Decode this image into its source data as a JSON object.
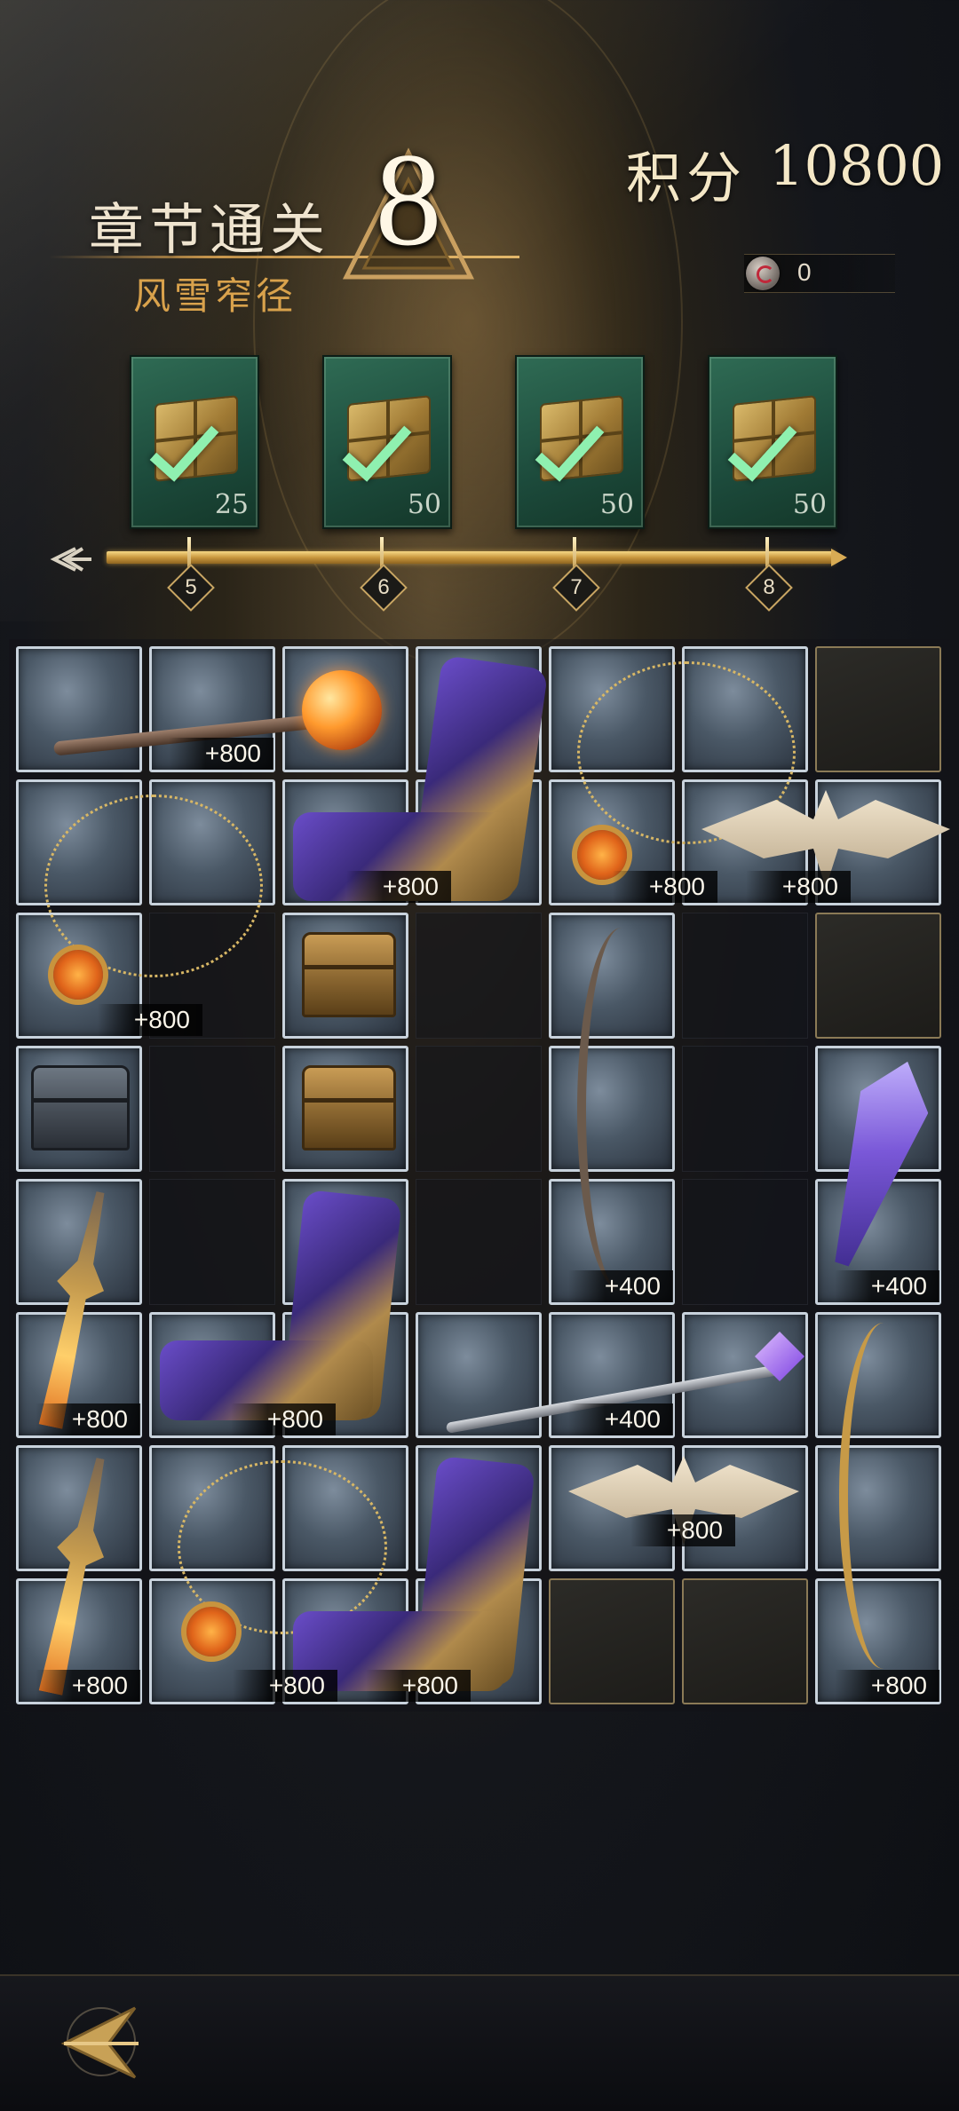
{
  "header": {
    "chapter_title": "章节通关",
    "chapter_subtitle": "风雪窄径",
    "chapter_number": "8",
    "score_label": "积分",
    "score_value": "10800",
    "currency_value": "0"
  },
  "rewards": [
    {
      "count": "25",
      "claimed": true
    },
    {
      "count": "50",
      "claimed": true
    },
    {
      "count": "50",
      "claimed": true
    },
    {
      "count": "50",
      "claimed": true
    }
  ],
  "milestones": [
    "5",
    "6",
    "7",
    "8"
  ],
  "grid": {
    "badges": [
      {
        "row": 0,
        "col": 1,
        "text": "+800"
      },
      {
        "row": 1,
        "col": 3,
        "text": "+800"
      },
      {
        "row": 1,
        "col": 5,
        "text": "+800"
      },
      {
        "row": 1,
        "col": 6,
        "text": "+800"
      },
      {
        "row": 2,
        "col": 1,
        "text": "+800"
      },
      {
        "row": 4,
        "col": 4,
        "text": "+400"
      },
      {
        "row": 4,
        "col": 6,
        "text": "+400"
      },
      {
        "row": 5,
        "col": 0,
        "text": "+800"
      },
      {
        "row": 5,
        "col": 2,
        "text": "+800"
      },
      {
        "row": 5,
        "col": 4,
        "text": "+400"
      },
      {
        "row": 6,
        "col": 5,
        "text": "+800"
      },
      {
        "row": 7,
        "col": 0,
        "text": "+800"
      },
      {
        "row": 7,
        "col": 2,
        "text": "+800"
      },
      {
        "row": 7,
        "col": 3,
        "text": "+800"
      },
      {
        "row": 7,
        "col": 6,
        "text": "+800"
      }
    ]
  },
  "icons": {
    "back": "back-arrow-icon",
    "currency": "coin-icon",
    "progress_tail": "arrow-tail-icon"
  },
  "colors": {
    "accent_gold": "#c9974d",
    "reward_green": "#2f6b54",
    "check_green": "#8ff0b0"
  }
}
